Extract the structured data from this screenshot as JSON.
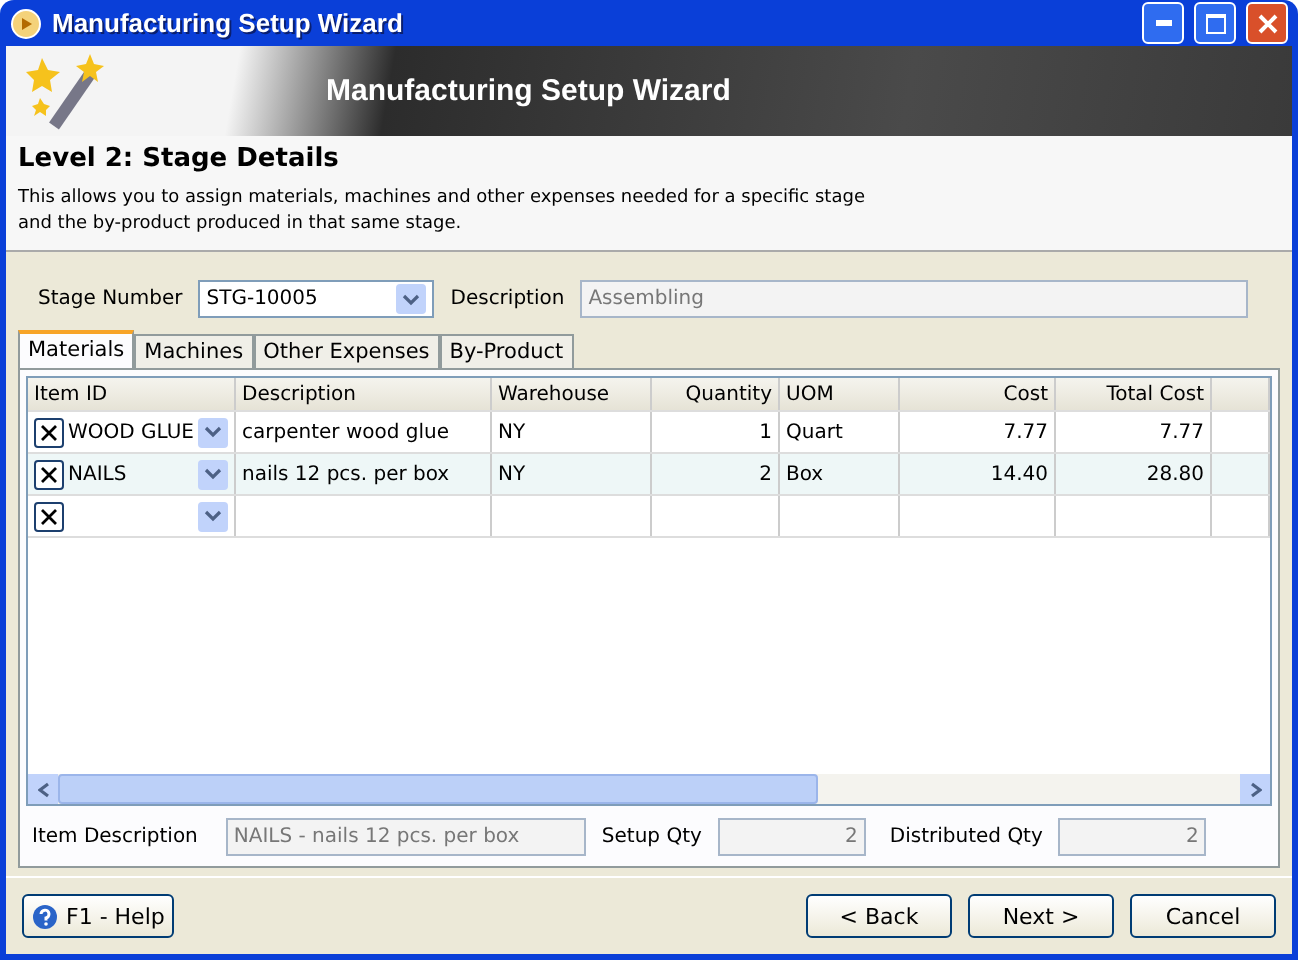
{
  "window": {
    "title": "Manufacturing Setup Wizard"
  },
  "banner": {
    "title": "Manufacturing Setup Wizard"
  },
  "heading": "Level 2: Stage Details",
  "intro": "This allows you to assign materials, machines and other expenses needed for a specific stage and the by-product produced in that same stage.",
  "stage": {
    "label": "Stage Number",
    "value": "STG-10005",
    "description_label": "Description",
    "description_value": "Assembling"
  },
  "tabs": [
    {
      "label": "Materials",
      "selected": true
    },
    {
      "label": "Machines",
      "selected": false
    },
    {
      "label": "Other Expenses",
      "selected": false
    },
    {
      "label": "By-Product",
      "selected": false
    }
  ],
  "table": {
    "columns": [
      "Item ID",
      "Description",
      "Warehouse",
      "Quantity",
      "UOM",
      "Cost",
      "Total Cost"
    ],
    "rows": [
      {
        "selected": false,
        "cells": [
          "WOOD GLUE",
          "carpenter wood glue",
          "NY",
          "1",
          "Quart",
          "7.77",
          "7.77"
        ]
      },
      {
        "selected": true,
        "cells": [
          "NAILS",
          "nails 12 pcs. per box",
          "NY",
          "2",
          "Box",
          "14.40",
          "28.80"
        ]
      },
      {
        "selected": false,
        "cells": [
          "",
          "",
          "",
          "",
          "",
          "",
          ""
        ]
      }
    ]
  },
  "details": {
    "item_description_label": "Item Description",
    "item_description": "NAILS - nails 12 pcs. per box",
    "setup_qty_label": "Setup Qty",
    "setup_qty": "2",
    "distributed_qty_label": "Distributed Qty",
    "distributed_qty": "2"
  },
  "help_button": "F1 - Help",
  "buttons": [
    "< Back",
    "Next >",
    "Cancel"
  ]
}
